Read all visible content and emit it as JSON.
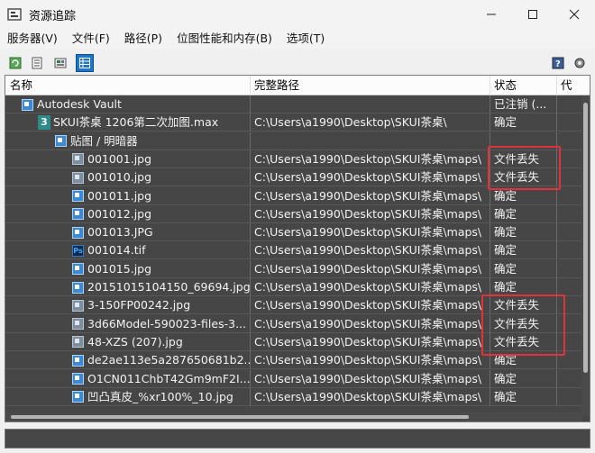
{
  "window": {
    "title": "资源追踪"
  },
  "menu": [
    "服务器(V)",
    "文件(F)",
    "路径(P)",
    "位图性能和内存(B)",
    "选项(T)"
  ],
  "columns": {
    "name": "名称",
    "path": "完整路径",
    "status": "状态",
    "proxy": "代"
  },
  "rows": [
    {
      "indent": 0,
      "icon": "vault",
      "name": "Autodesk Vault",
      "path": "",
      "status": "已注销 (..."
    },
    {
      "indent": 1,
      "icon": "max",
      "name": "SKUI茶桌 1206第二次加图.max",
      "path": "C:\\Users\\a1990\\Desktop\\SKUI茶桌\\",
      "status": "确定"
    },
    {
      "indent": 2,
      "icon": "folder",
      "name": "贴图 / 明暗器",
      "path": "",
      "status": ""
    },
    {
      "indent": 3,
      "icon": "missing",
      "name": "001001.jpg",
      "path": "C:\\Users\\a1990\\Desktop\\SKUI茶桌\\maps\\",
      "status": "文件丢失"
    },
    {
      "indent": 3,
      "icon": "missing",
      "name": "001010.jpg",
      "path": "C:\\Users\\a1990\\Desktop\\SKUI茶桌\\maps\\",
      "status": "文件丢失"
    },
    {
      "indent": 3,
      "icon": "image",
      "name": "001011.jpg",
      "path": "C:\\Users\\a1990\\Desktop\\SKUI茶桌\\maps\\",
      "status": "确定"
    },
    {
      "indent": 3,
      "icon": "image",
      "name": "001012.jpg",
      "path": "C:\\Users\\a1990\\Desktop\\SKUI茶桌\\maps\\",
      "status": "确定"
    },
    {
      "indent": 3,
      "icon": "image",
      "name": "001013.JPG",
      "path": "C:\\Users\\a1990\\Desktop\\SKUI茶桌\\maps\\",
      "status": "确定"
    },
    {
      "indent": 3,
      "icon": "ps",
      "name": "001014.tif",
      "path": "C:\\Users\\a1990\\Desktop\\SKUI茶桌\\maps\\",
      "status": "确定"
    },
    {
      "indent": 3,
      "icon": "image",
      "name": "001015.jpg",
      "path": "C:\\Users\\a1990\\Desktop\\SKUI茶桌\\maps\\",
      "status": "确定"
    },
    {
      "indent": 3,
      "icon": "image",
      "name": "20151015104150_69694.jpg",
      "path": "C:\\Users\\a1990\\Desktop\\SKUI茶桌\\maps\\",
      "status": "确定"
    },
    {
      "indent": 3,
      "icon": "missing",
      "name": "3-150FP00242.jpg",
      "path": "C:\\Users\\a1990\\Desktop\\SKUI茶桌\\maps\\",
      "status": "文件丢失"
    },
    {
      "indent": 3,
      "icon": "missing",
      "name": "3d66Model-590023-files-3...",
      "path": "C:\\Users\\a1990\\Desktop\\SKUI茶桌\\maps\\",
      "status": "文件丢失"
    },
    {
      "indent": 3,
      "icon": "missing",
      "name": "48-XZS (207).jpg",
      "path": "C:\\Users\\a1990\\Desktop\\SKUI茶桌\\maps\\",
      "status": "文件丢失"
    },
    {
      "indent": 3,
      "icon": "image",
      "name": "de2ae113e5a287650681b2...",
      "path": "C:\\Users\\a1990\\Desktop\\SKUI茶桌\\maps\\",
      "status": "确定"
    },
    {
      "indent": 3,
      "icon": "image",
      "name": "O1CN011ChbT42Gm9mF2I...",
      "path": "C:\\Users\\a1990\\Desktop\\SKUI茶桌\\maps\\",
      "status": "确定"
    },
    {
      "indent": 3,
      "icon": "image",
      "name": "凹凸真皮_%xr100%_10.jpg",
      "path": "C:\\Users\\a1990\\Desktop\\SKUI茶桌\\maps\\",
      "status": "确定"
    }
  ],
  "toolbar": {
    "active_button": "details-view"
  },
  "colors": {
    "list_bg": "#464646",
    "highlight": "#e0323a",
    "selected_tool": "#1f76c5"
  }
}
